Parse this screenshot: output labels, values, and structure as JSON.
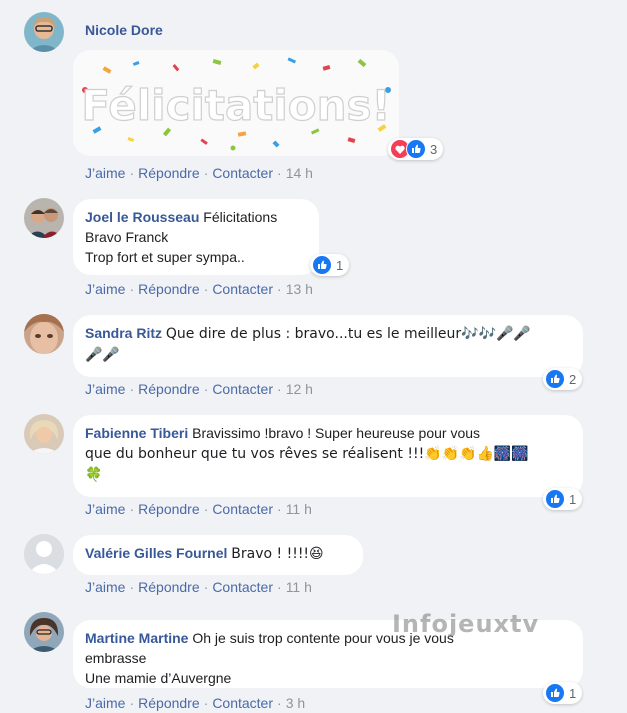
{
  "comments": [
    {
      "name": "Nicole Dore",
      "text": "",
      "sticker_text": "Félicitations!",
      "reaction_count": "3",
      "actions": {
        "like": "J’aime",
        "reply": "Répondre",
        "contact": "Contacter",
        "time": "14 h"
      }
    },
    {
      "name": "Joel le Rousseau",
      "lines": [
        "Félicitations",
        "Bravo Franck",
        "Trop fort et super sympa.."
      ],
      "reaction_count": "1",
      "actions": {
        "like": "J’aime",
        "reply": "Répondre",
        "contact": "Contacter",
        "time": "13 h"
      }
    },
    {
      "name": "Sandra Ritz",
      "line1": "Que dire de plus : bravo...tu es le meilleur🎶🎶🎤🎤",
      "line2": "🎤🎤",
      "reaction_count": "2",
      "actions": {
        "like": "J’aime",
        "reply": "Répondre",
        "contact": "Contacter",
        "time": "12 h"
      }
    },
    {
      "name": "Fabienne Tiberi",
      "line1": "Bravissimo !bravo ! Super heureuse pour vous",
      "line2": "que du bonheur que tu vos rêves se réalisent !!!👏👏👏👍🎆🎆",
      "line3": "🍀",
      "reaction_count": "1",
      "actions": {
        "like": "J’aime",
        "reply": "Répondre",
        "contact": "Contacter",
        "time": "11 h"
      }
    },
    {
      "name": "Valérie Gilles Fournel",
      "text": "Bravo ! !!!!😆",
      "actions": {
        "like": "J’aime",
        "reply": "Répondre",
        "contact": "Contacter",
        "time": "11 h"
      }
    },
    {
      "name": "Martine Martine",
      "line1": "Oh je suis trop contente pour vous je vous",
      "line2": "embrasse",
      "line3": "Une mamie d’Auvergne",
      "reaction_count": "1",
      "actions": {
        "like": "J’aime",
        "reply": "Répondre",
        "contact": "Contacter",
        "time": "3 h"
      }
    }
  ],
  "watermark": "Infojeuxtv",
  "icons": {
    "like": "like-icon",
    "love": "love-icon",
    "avatar": "avatar"
  },
  "colors": {
    "background": "#f0f2f5",
    "name": "#385898",
    "link": "#4b6aa8",
    "like": "#1877f2",
    "love": "#f33e58"
  }
}
